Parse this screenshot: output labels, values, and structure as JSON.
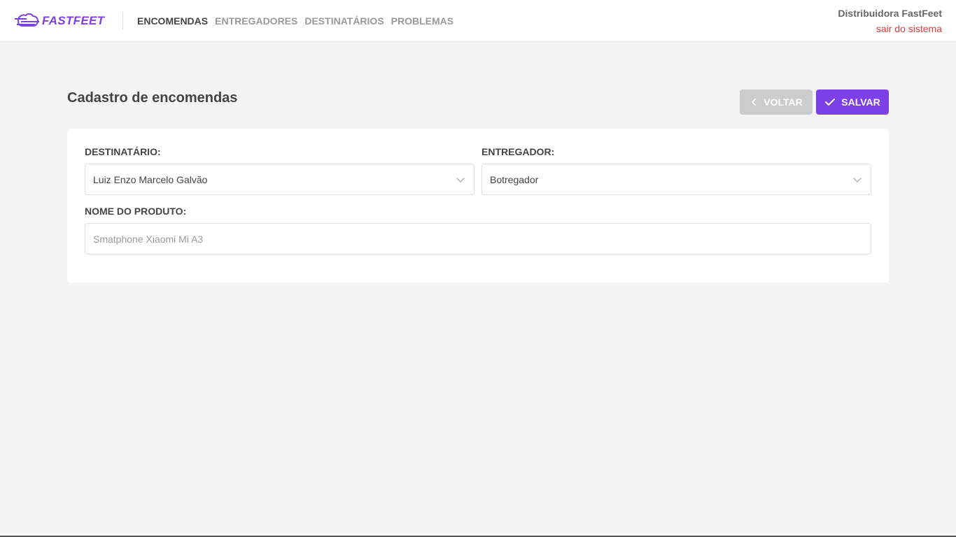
{
  "brand": {
    "name": "FASTFEET",
    "accent": "#7d40e7"
  },
  "nav": {
    "items": [
      {
        "label": "ENCOMENDAS",
        "active": true
      },
      {
        "label": "ENTREGADORES",
        "active": false
      },
      {
        "label": "DESTINATÁRIOS",
        "active": false
      },
      {
        "label": "PROBLEMAS",
        "active": false
      }
    ]
  },
  "profile": {
    "name": "Distribuidora FastFeet",
    "logout": "sair do sistema"
  },
  "page": {
    "title": "Cadastro de encomendas"
  },
  "actions": {
    "back_label": "VOLTAR",
    "save_label": "SALVAR"
  },
  "form": {
    "recipient_label": "DESTINATÁRIO:",
    "recipient_value": "Luiz Enzo Marcelo Galvão",
    "deliveryman_label": "ENTREGADOR:",
    "deliveryman_value": "Botregador",
    "product_label": "NOME DO PRODUTO:",
    "product_placeholder": "Smatphone Xiaomi Mi A3",
    "product_value": ""
  },
  "colors": {
    "background": "#f4f4f4",
    "primary": "#7d40e7",
    "secondary_button": "#cccccc",
    "logout": "#de3b3b"
  }
}
